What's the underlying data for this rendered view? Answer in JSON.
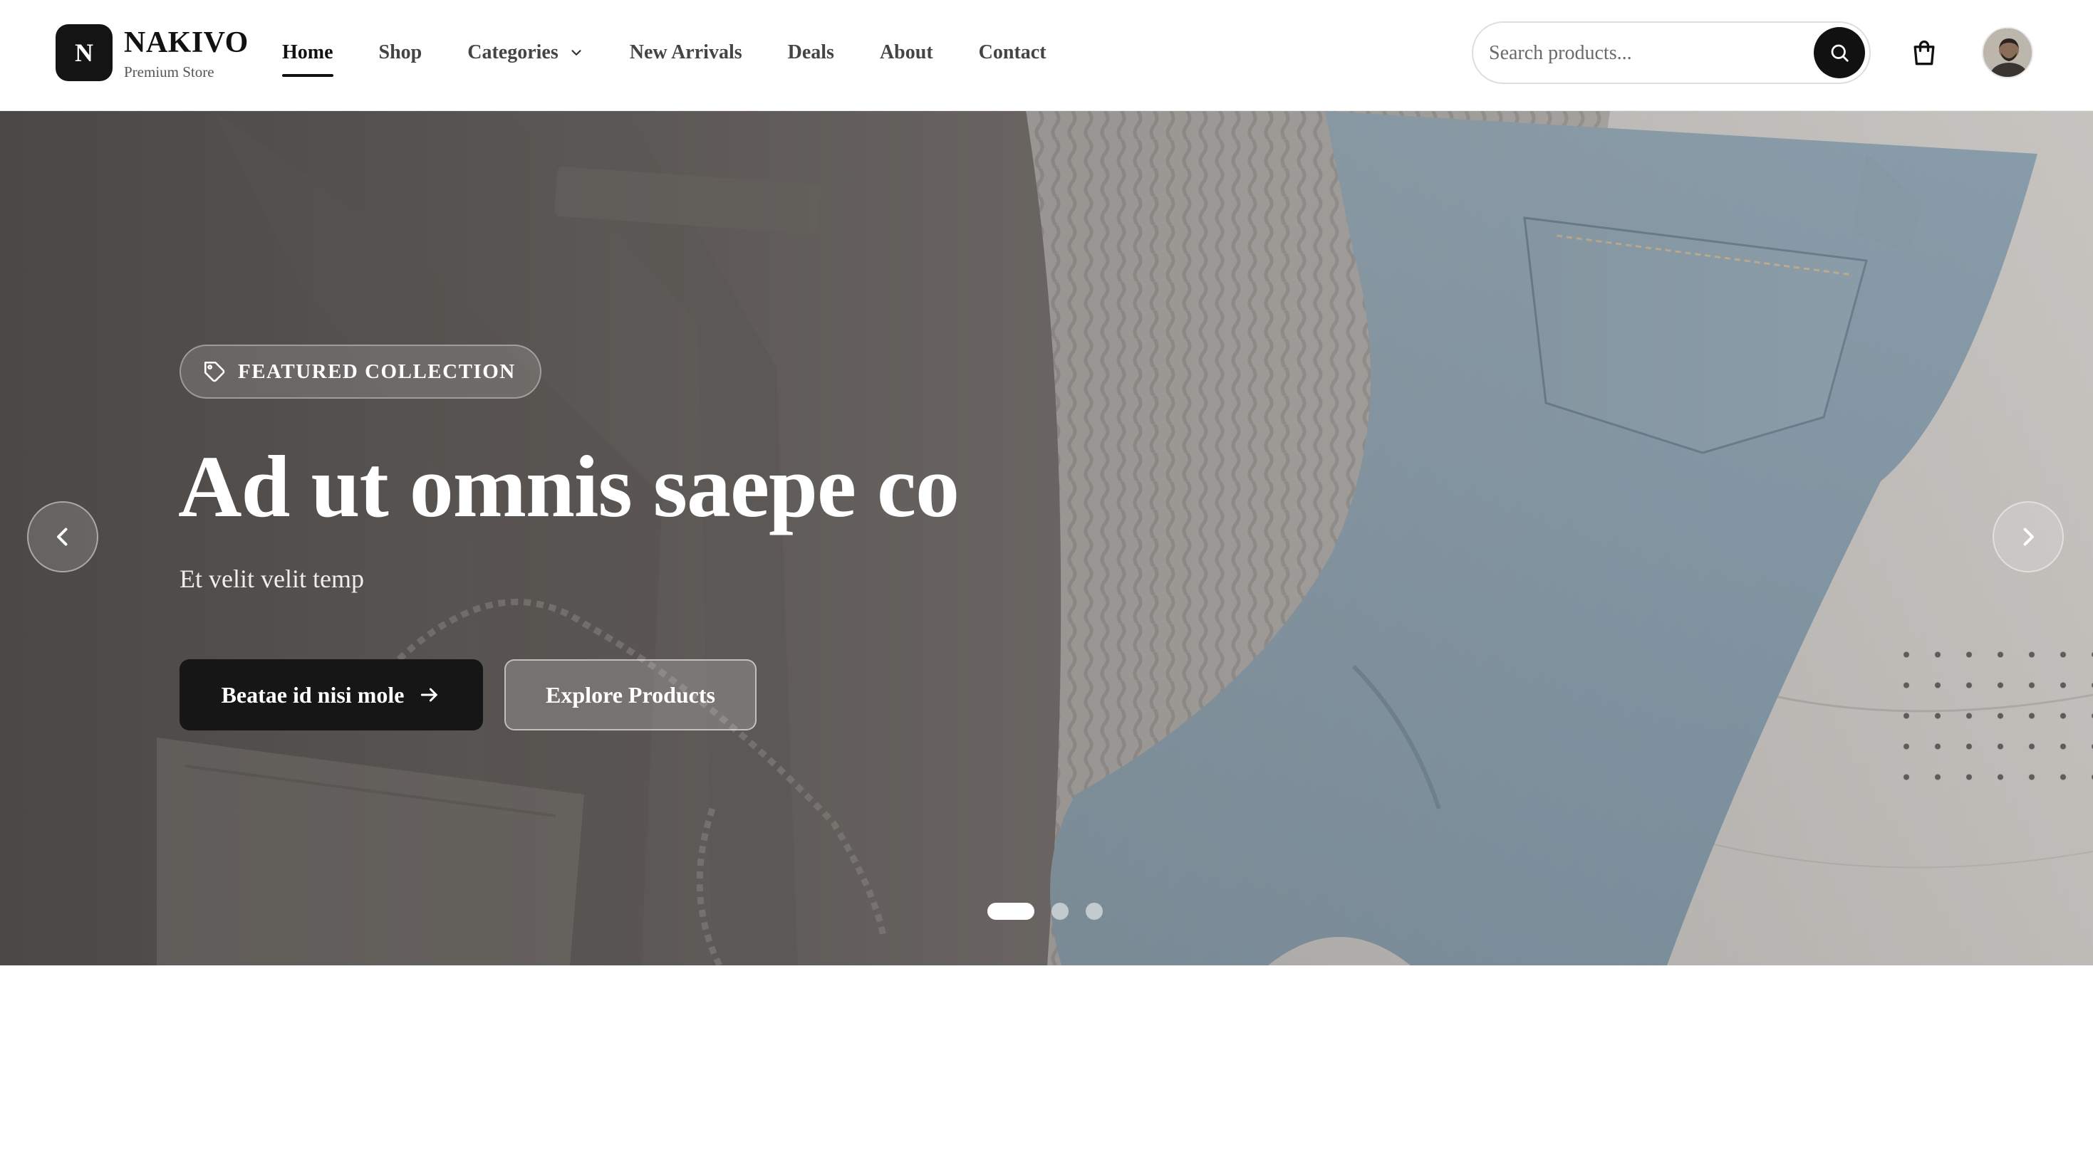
{
  "brand": {
    "logo_letter": "N",
    "name": "NAKIVO",
    "tagline": "Premium Store"
  },
  "nav": {
    "items": [
      {
        "label": "Home",
        "active": true
      },
      {
        "label": "Shop",
        "active": false
      },
      {
        "label": "Categories",
        "active": false,
        "has_dropdown": true
      },
      {
        "label": "New Arrivals",
        "active": false
      },
      {
        "label": "Deals",
        "active": false
      },
      {
        "label": "About",
        "active": false
      },
      {
        "label": "Contact",
        "active": false
      }
    ]
  },
  "search": {
    "placeholder": "Search products...",
    "icon": "search-icon"
  },
  "header_icons": {
    "cart": "shopping-bag-icon",
    "avatar": "user-avatar"
  },
  "hero": {
    "badge_icon": "tag-icon",
    "badge_label": "FEATURED COLLECTION",
    "title": "Ad ut omnis saepe co",
    "subtitle": "Et velit velit temp",
    "primary_cta": "Beatae id nisi mole",
    "secondary_cta": "Explore Products",
    "slides_total": 3,
    "active_slide": 1
  },
  "colors": {
    "primary": "#141414",
    "background": "#ffffff",
    "text_light": "#ffffff"
  }
}
